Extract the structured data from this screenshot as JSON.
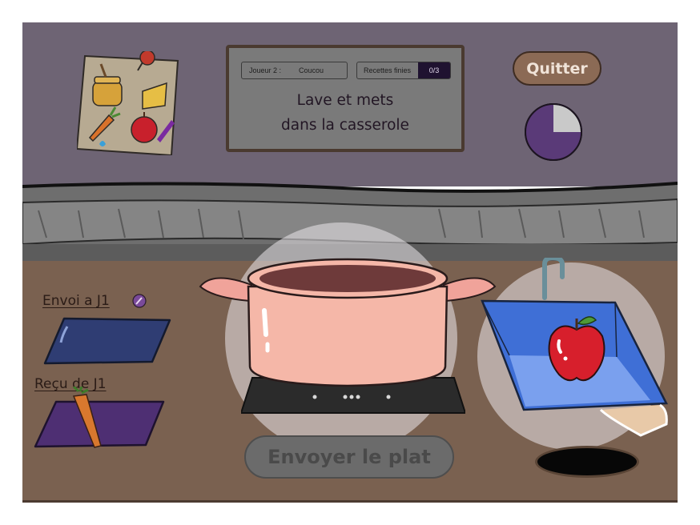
{
  "board": {
    "player_label": "Joueur 2 :",
    "player_name": "Coucou",
    "recipes_label": "Recettes finies",
    "recipes_count": "0/3",
    "instruction_line1": "Lave et mets",
    "instruction_line2": "dans la casserole"
  },
  "buttons": {
    "quit": "Quitter",
    "send_dish": "Envoyer le plat"
  },
  "stations": {
    "send_label": "Envoi a J1",
    "receive_label": "Reçu de J1"
  },
  "timer": {
    "elapsed_fraction": 0.25,
    "color": "#5a3a78"
  },
  "recipe_ingredients": [
    "honey-jar",
    "cheese",
    "carrot",
    "apple"
  ],
  "received_item": "carrot",
  "sink_item": "apple",
  "colors": {
    "wall": "#6e6474",
    "counter": "#7a6150",
    "send_tray": "#2f3d73",
    "receive_tray": "#4e2f73",
    "sink": "#3f6fd6",
    "pot": "#f4b8a8"
  }
}
